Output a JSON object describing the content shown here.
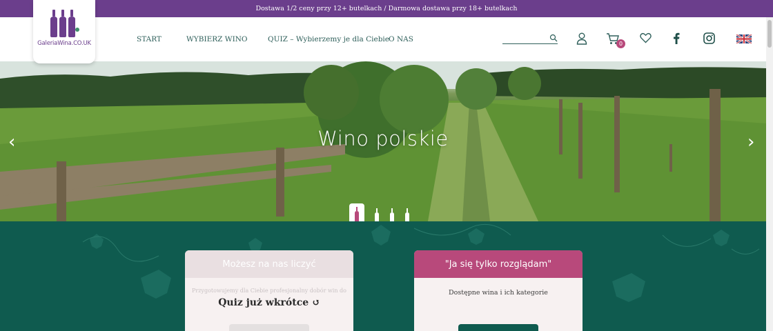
{
  "topbar": {
    "text": "Dostawa 1/2 ceny przy 12+ butelkach / Darmowa dostawa przy 18+ butelkach"
  },
  "logo": {
    "text": "GaleriaWina.CO.UK"
  },
  "nav": {
    "items": [
      {
        "label": "START"
      },
      {
        "label": "WYBIERZ WINO"
      },
      {
        "label": "QUIZ – Wybierzemy je dla Ciebie"
      },
      {
        "label": "O NAS"
      }
    ]
  },
  "header": {
    "search_value": "",
    "cart_count": "0",
    "icons": [
      "search-icon",
      "user-icon",
      "cart-icon",
      "heart-icon",
      "facebook-icon",
      "instagram-icon",
      "uk-flag-icon"
    ]
  },
  "hero": {
    "title": "Wino polskie",
    "prev": "‹",
    "next": "›",
    "slides": 4,
    "active_slide": 1
  },
  "cards": [
    {
      "title": "Możesz na nas liczyć",
      "subtitle": "Przygotowujemy dla Ciebie profesjonalny dobór win do",
      "overlay": "Quiz już wkrótce ↺"
    },
    {
      "title": "\"Ja się tylko rozglądam\"",
      "subtitle": "Dostępne wina i ich kategorie"
    }
  ],
  "colors": {
    "purple": "#6b3e8c",
    "teal": "#0f5b4f",
    "pink": "#b8497b"
  }
}
